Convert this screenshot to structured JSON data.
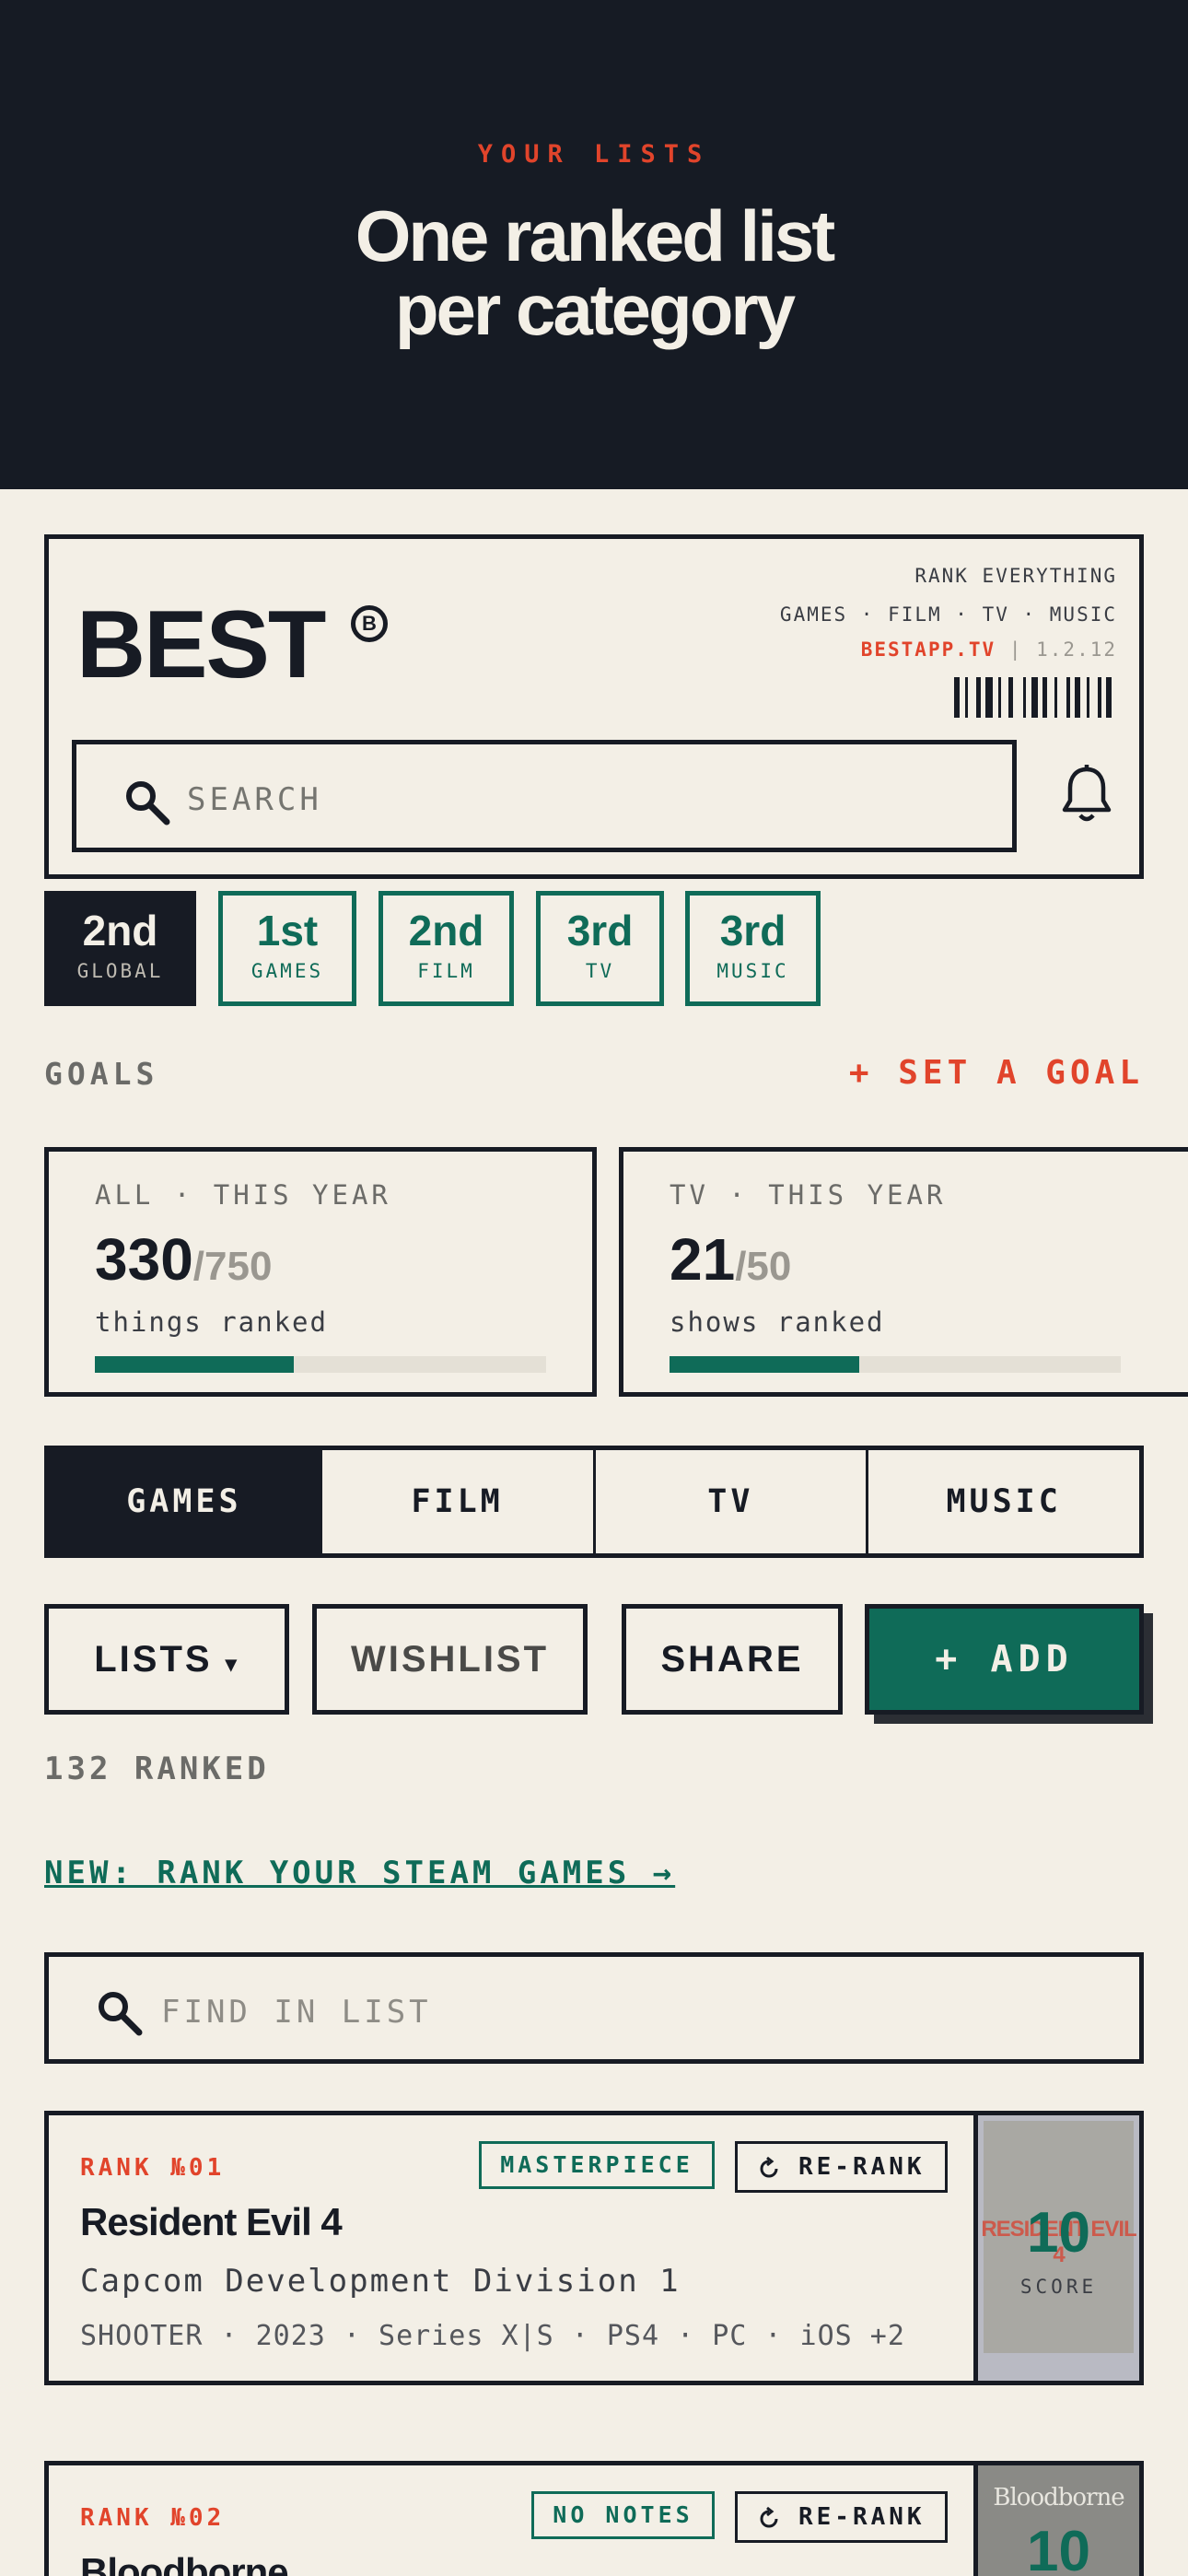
{
  "hero": {
    "eyebrow": "YOUR LISTS",
    "title_line1": "One ranked list",
    "title_line2": "per category"
  },
  "brand": {
    "logo": "BEST",
    "logo_mark": "B",
    "tagline": "RANK EVERYTHING",
    "categories_line": "GAMES · FILM · TV · MUSIC",
    "site": "BESTAPP.TV",
    "separator": "|",
    "version": "1.2.12"
  },
  "search": {
    "placeholder": "SEARCH"
  },
  "ranks": [
    {
      "value": "2nd",
      "label": "GLOBAL"
    },
    {
      "value": "1st",
      "label": "GAMES"
    },
    {
      "value": "2nd",
      "label": "FILM"
    },
    {
      "value": "3rd",
      "label": "TV"
    },
    {
      "value": "3rd",
      "label": "MUSIC"
    }
  ],
  "goals": {
    "label": "GOALS",
    "set_goal": "+ SET A GOAL",
    "cards": [
      {
        "category": "ALL · THIS YEAR",
        "count": "330",
        "target": "/750",
        "description": "things ranked",
        "progress": 0.44
      },
      {
        "category": "TV · THIS YEAR",
        "count": "21",
        "target": "/50",
        "description": "shows ranked",
        "progress": 0.42
      }
    ]
  },
  "tabs": [
    "GAMES",
    "FILM",
    "TV",
    "MUSIC"
  ],
  "actions": {
    "lists": "LISTS",
    "lists_caret": "▾",
    "wishlist": "WISHLIST",
    "share": "SHARE",
    "add": "+ ADD"
  },
  "ranked_count": "132 RANKED",
  "steam_link": "NEW: RANK YOUR STEAM GAMES →",
  "find": {
    "placeholder": "FIND IN LIST"
  },
  "items": [
    {
      "rank": "RANK №01",
      "tag": "MASTERPIECE",
      "rerank": "RE-RANK",
      "title": "Resident Evil 4",
      "studio": "Capcom Development Division 1",
      "meta": "SHOOTER · 2023 · Series X|S · PS4 · PC · iOS +2",
      "cover_text": "RESIDENT EVIL 4",
      "score": "10",
      "score_label": "SCORE"
    },
    {
      "rank": "RANK №02",
      "tag": "NO NOTES",
      "rerank": "RE-RANK",
      "title": "Bloodborne",
      "cover_text": "Bloodborne",
      "score": "10"
    }
  ],
  "colors": {
    "ink": "#171b24",
    "paper": "#f3efe6",
    "accent_red": "#e1442b",
    "accent_green": "#0f6b58"
  }
}
